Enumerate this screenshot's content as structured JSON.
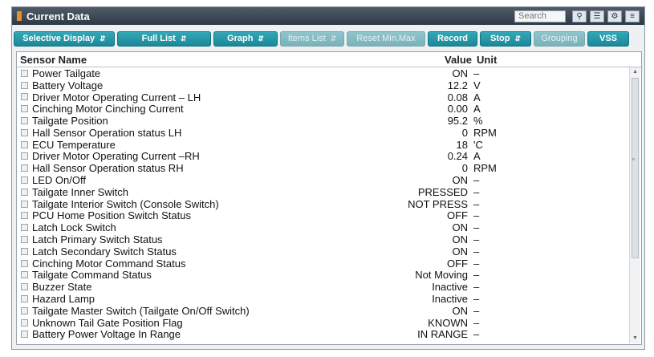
{
  "window": {
    "title": "Current Data",
    "search_placeholder": "Search"
  },
  "toolbar": {
    "selective_display": "Selective Display",
    "full_list": "Full List",
    "graph": "Graph",
    "items_list": "Items List",
    "reset_min_max": "Reset Min.Max",
    "record": "Record",
    "stop": "Stop",
    "grouping": "Grouping",
    "vss": "VSS"
  },
  "table": {
    "headers": {
      "name": "Sensor Name",
      "value": "Value",
      "unit": "Unit"
    },
    "rows": [
      {
        "name": "Power Tailgate",
        "value": "ON",
        "unit": "–"
      },
      {
        "name": "Battery Voltage",
        "value": "12.2",
        "unit": "V"
      },
      {
        "name": "Driver Motor Operating Current – LH",
        "value": "0.08",
        "unit": "A"
      },
      {
        "name": "Cinching Motor Cinching Current",
        "value": "0.00",
        "unit": "A"
      },
      {
        "name": "Tailgate Position",
        "value": "95.2",
        "unit": "%"
      },
      {
        "name": "Hall Sensor Operation status LH",
        "value": "0",
        "unit": "RPM"
      },
      {
        "name": "ECU Temperature",
        "value": "18",
        "unit": "'C"
      },
      {
        "name": "Driver Motor Operating Current –RH",
        "value": "0.24",
        "unit": "A"
      },
      {
        "name": "Hall Sensor Operation status RH",
        "value": "0",
        "unit": "RPM"
      },
      {
        "name": "LED On/Off",
        "value": "ON",
        "unit": "–"
      },
      {
        "name": "Tailgate Inner Switch",
        "value": "PRESSED",
        "unit": "–"
      },
      {
        "name": "Tailgate Interior Switch (Console Switch)",
        "value": "NOT PRESS",
        "unit": "–"
      },
      {
        "name": "PCU Home Position Switch Status",
        "value": "OFF",
        "unit": "–"
      },
      {
        "name": "Latch Lock Switch",
        "value": "ON",
        "unit": "–"
      },
      {
        "name": "Latch Primary Switch Status",
        "value": "ON",
        "unit": "–"
      },
      {
        "name": "Latch Secondary Switch Status",
        "value": "ON",
        "unit": "–"
      },
      {
        "name": "Cinching Motor Command Status",
        "value": "OFF",
        "unit": "–"
      },
      {
        "name": "Tailgate Command Status",
        "value": "Not Moving",
        "unit": "–"
      },
      {
        "name": "Buzzer State",
        "value": "Inactive",
        "unit": "–"
      },
      {
        "name": "Hazard Lamp",
        "value": "Inactive",
        "unit": "–"
      },
      {
        "name": "Tailgate Master Switch (Tailgate On/Off Switch)",
        "value": "ON",
        "unit": "–"
      },
      {
        "name": "Unknown Tail Gate Position Flag",
        "value": "KNOWN",
        "unit": "–"
      },
      {
        "name": "Battery Power Voltage In Range",
        "value": "IN RANGE",
        "unit": "–"
      }
    ]
  },
  "colors": {
    "accent": "#1b8797",
    "titlebar": "#2f3945",
    "title_flag": "#e4902d"
  }
}
